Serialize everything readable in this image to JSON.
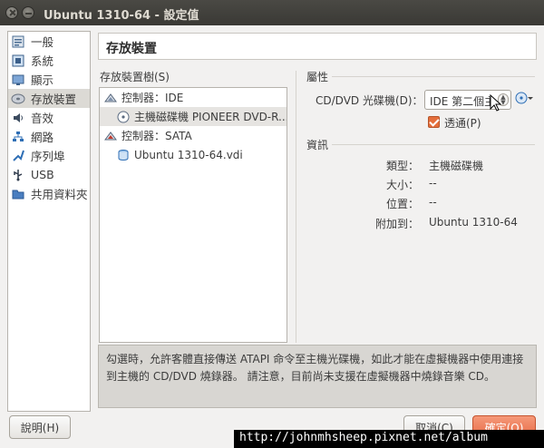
{
  "window": {
    "title": "Ubuntu 1310-64 - 設定值"
  },
  "sidebar": {
    "items": [
      {
        "label": "一般",
        "icon": "general-icon"
      },
      {
        "label": "系統",
        "icon": "system-icon"
      },
      {
        "label": "顯示",
        "icon": "display-icon"
      },
      {
        "label": "存放裝置",
        "icon": "storage-icon",
        "selected": true
      },
      {
        "label": "音效",
        "icon": "audio-icon"
      },
      {
        "label": "網路",
        "icon": "network-icon"
      },
      {
        "label": "序列埠",
        "icon": "serial-port-icon"
      },
      {
        "label": "USB",
        "icon": "usb-icon"
      },
      {
        "label": "共用資料夾",
        "icon": "shared-folder-icon"
      }
    ]
  },
  "header": {
    "title": "存放裝置"
  },
  "tree": {
    "label": "存放裝置樹(S)",
    "rows": [
      {
        "label": "控制器：IDE",
        "icon": "ide-controller-icon",
        "indent": 0
      },
      {
        "label": "主機磁碟機 PIONEER DVD-R...",
        "icon": "optical-disc-icon",
        "indent": 1,
        "selected": true
      },
      {
        "label": "控制器：SATA",
        "icon": "sata-controller-icon",
        "indent": 0
      },
      {
        "label": "Ubuntu 1310-64.vdi",
        "icon": "hard-disk-icon",
        "indent": 1
      }
    ]
  },
  "attributes": {
    "title": "屬性",
    "drive_label": "CD/DVD 光碟機(D)：",
    "drive_value": "IDE 第二個主",
    "passthrough_label": "透通(P)",
    "passthrough_checked": true
  },
  "info": {
    "title": "資訊",
    "rows": [
      {
        "label": "類型：",
        "value": "主機磁碟機"
      },
      {
        "label": "大小：",
        "value": "--"
      },
      {
        "label": "位置：",
        "value": "--"
      },
      {
        "label": "附加到：",
        "value": "Ubuntu 1310-64"
      }
    ]
  },
  "description": "勾選時，允許客體直接傳送 ATAPI 命令至主機光碟機，如此才能在虛擬機器中使用連接到主機的 CD/DVD 燒錄器。 請注意，目前尚未支援在虛擬機器中燒錄音樂 CD。",
  "buttons": {
    "help": "說明(H)",
    "cancel": "取消(C)",
    "ok": "確定(O)"
  },
  "watermark": "http://johnmhsheep.pixnet.net/album",
  "colors": {
    "accent": "#e76b47",
    "titlebar": "#3c3b37",
    "window_bg": "#f2f1f0"
  }
}
